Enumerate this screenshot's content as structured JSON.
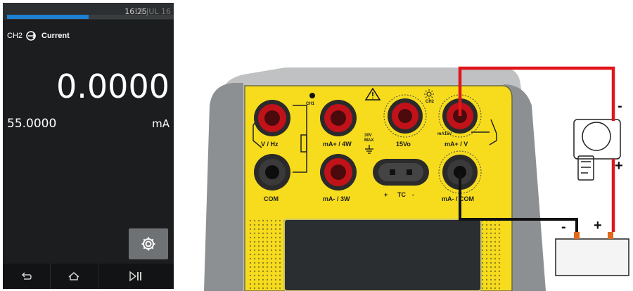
{
  "device": {
    "time": "16:25",
    "date": "19 JUL 16",
    "progress": 0.49,
    "channel_label": "CH2",
    "function_label": "Current",
    "main_reading": "0.0000",
    "secondary_reading": "55.0000",
    "unit": "mA"
  },
  "panel": {
    "ch1_label": "CH1",
    "ch2_label": "CH2",
    "jacks": {
      "v_hz": "V / Hz",
      "ma_4w": "mA+ / 4W",
      "v15": "15Vo",
      "ma_v": "mA+ / V",
      "com": "COM",
      "ma_3w": "mA- / 3W",
      "ma_com": "mA- / COM"
    },
    "tc_label": "TC",
    "tc_plus": "+",
    "tc_minus": "-",
    "max_label_line1": "30V",
    "max_label_line2": "MAX",
    "ma15v_label": "mA15V"
  },
  "circuit": {
    "load_minus": "-",
    "load_plus": "+",
    "battery_minus": "-",
    "battery_plus": "+",
    "wire_colors": {
      "positive": "#e0161b",
      "negative": "#111111"
    }
  }
}
